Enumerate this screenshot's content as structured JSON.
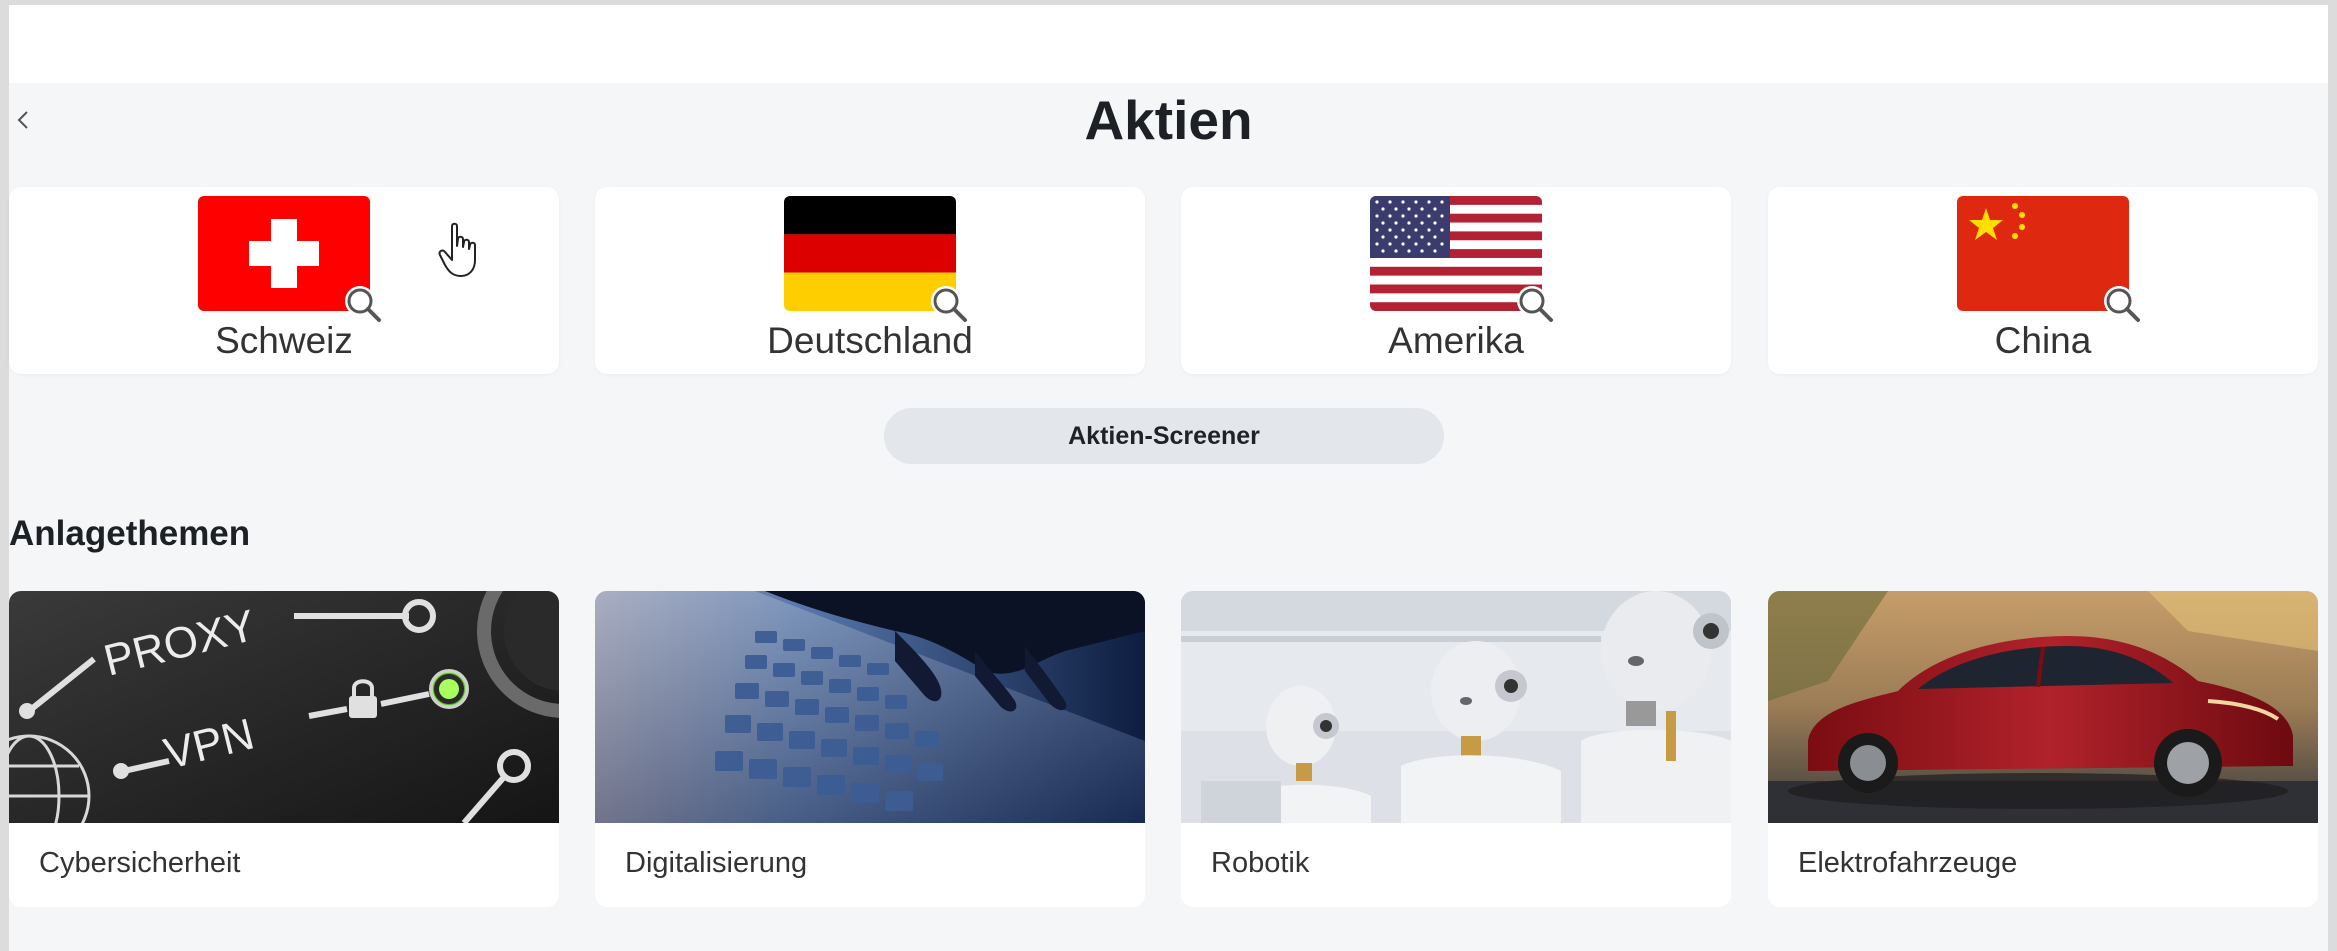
{
  "header": {
    "title": "Aktien"
  },
  "countries": [
    {
      "label": "Schweiz",
      "flag": "ch-flag-icon"
    },
    {
      "label": "Deutschland",
      "flag": "de-flag-icon"
    },
    {
      "label": "Amerika",
      "flag": "us-flag-icon"
    },
    {
      "label": "China",
      "flag": "cn-flag-icon"
    }
  ],
  "screener": {
    "label": "Aktien-Screener"
  },
  "themes": {
    "title": "Anlagethemen",
    "items": [
      {
        "label": "Cybersicherheit",
        "image": "cybersecurity-image"
      },
      {
        "label": "Digitalisierung",
        "image": "keyboard-image"
      },
      {
        "label": "Robotik",
        "image": "robots-image"
      },
      {
        "label": "Elektrofahrzeuge",
        "image": "electric-car-image"
      }
    ]
  },
  "cybersecurity_image_text": {
    "proxy": "PROXY",
    "vpn": "VPN"
  },
  "colors": {
    "background": "#f4f6f8",
    "card": "#ffffff",
    "button": "#e3e6ea",
    "swiss_red": "#ff0000",
    "china_red": "#de2910",
    "china_yellow": "#ffde00"
  }
}
